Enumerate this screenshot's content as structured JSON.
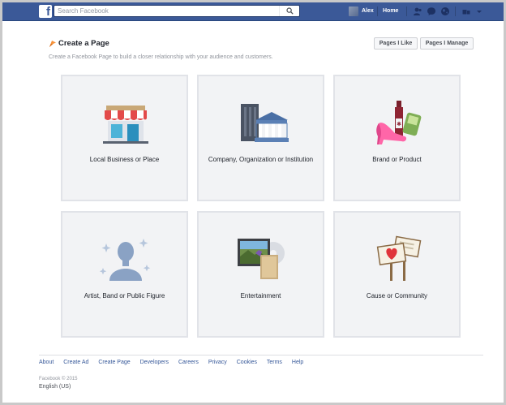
{
  "topbar": {
    "search_placeholder": "Search Facebook",
    "user_name": "Alex",
    "home_label": "Home",
    "brand_color": "#3b5998"
  },
  "header": {
    "title": "Create a Page",
    "subtitle": "Create a Facebook Page to build a closer relationship with your audience and customers.",
    "pages_i_like": "Pages I Like",
    "pages_i_manage": "Pages I Manage"
  },
  "categories": [
    {
      "label": "Local Business or Place",
      "icon": "storefront-icon"
    },
    {
      "label": "Company, Organization or Institution",
      "icon": "buildings-icon"
    },
    {
      "label": "Brand or Product",
      "icon": "products-icon"
    },
    {
      "label": "Artist, Band or Public Figure",
      "icon": "person-icon"
    },
    {
      "label": "Entertainment",
      "icon": "media-icon"
    },
    {
      "label": "Cause or Community",
      "icon": "signs-icon"
    }
  ],
  "footer": {
    "links": [
      "About",
      "Create Ad",
      "Create Page",
      "Developers",
      "Careers",
      "Privacy",
      "Cookies",
      "Terms",
      "Help"
    ],
    "copyright": "Facebook © 2015",
    "locale": "English (US)"
  }
}
